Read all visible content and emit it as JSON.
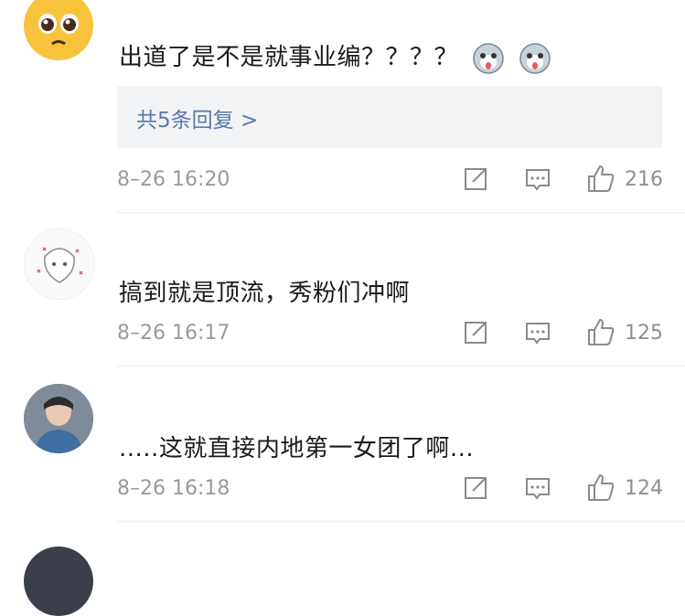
{
  "comments": [
    {
      "text": "出道了是不是就事业编？？？？",
      "replies_label": "共5条回复 >",
      "time": "8–26 16:20",
      "likes": "216",
      "emoji": [
        "husky-emoji",
        "husky-emoji"
      ]
    },
    {
      "text": "搞到就是顶流，秀粉们冲啊",
      "time": "8–26 16:17",
      "likes": "125"
    },
    {
      "text": ".....这就直接内地第一女团了啊...",
      "time": "8–26 16:18",
      "likes": "124"
    }
  ],
  "colors": {
    "link": "#5a79a8",
    "meta": "#9a9a9a",
    "reply_bg": "#f2f3f5"
  }
}
